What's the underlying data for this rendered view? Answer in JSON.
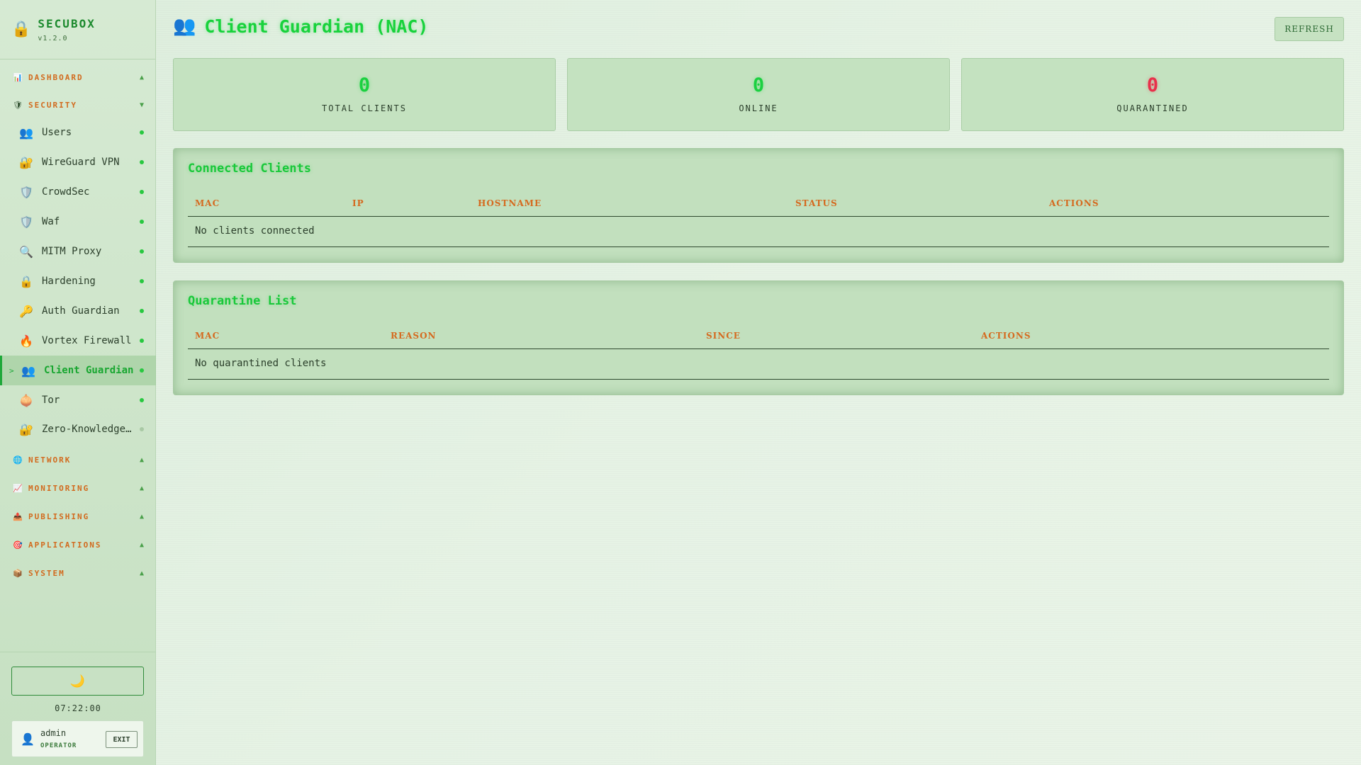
{
  "brand": {
    "title": "SECUBOX",
    "version": "v1.2.0",
    "icon": "lock-icon"
  },
  "nav": {
    "groups": [
      {
        "key": "dashboard",
        "label": "DASHBOARD",
        "icon": "📊",
        "chevron": "▲"
      },
      {
        "key": "security",
        "label": "SECURITY",
        "icon": "🛡",
        "chevron": "▼"
      },
      {
        "key": "network",
        "label": "NETWORK",
        "icon": "🌐",
        "chevron": "▲"
      },
      {
        "key": "monitoring",
        "label": "MONITORING",
        "icon": "📈",
        "chevron": "▲"
      },
      {
        "key": "publishing",
        "label": "PUBLISHING",
        "icon": "📤",
        "chevron": "▲"
      },
      {
        "key": "applications",
        "label": "APPLICATIONS",
        "icon": "🎯",
        "chevron": "▲"
      },
      {
        "key": "system",
        "label": "SYSTEM",
        "icon": "📦",
        "chevron": "▲"
      }
    ],
    "security_items": [
      {
        "label": "Users",
        "icon": "👥",
        "status": "online"
      },
      {
        "label": "WireGuard VPN",
        "icon": "🔐",
        "status": "online"
      },
      {
        "label": "CrowdSec",
        "icon": "🛡️",
        "status": "online"
      },
      {
        "label": "Waf",
        "icon": "🛡️",
        "status": "online"
      },
      {
        "label": "MITM Proxy",
        "icon": "🔍",
        "status": "online"
      },
      {
        "label": "Hardening",
        "icon": "🔒",
        "status": "online"
      },
      {
        "label": "Auth Guardian",
        "icon": "🔑",
        "status": "online"
      },
      {
        "label": "Vortex Firewall",
        "icon": "🔥",
        "status": "online"
      },
      {
        "label": "Client Guardian",
        "icon": "👥",
        "status": "online",
        "active": true
      },
      {
        "label": "Tor",
        "icon": "🧅",
        "status": "online"
      },
      {
        "label": "Zero-Knowledge…",
        "icon": "🔐",
        "status": "offline"
      }
    ],
    "active_marker": ">"
  },
  "footer": {
    "theme_icon": "🌙",
    "clock": "07:22:00",
    "user": {
      "name": "admin",
      "role": "OPERATOR",
      "icon": "👤",
      "exit_label": "EXIT"
    }
  },
  "header": {
    "title": "Client Guardian (NAC)",
    "icon": "👥",
    "refresh_label": "REFRESH"
  },
  "stats": [
    {
      "value": "0",
      "label": "TOTAL CLIENTS",
      "color": "#1bd040"
    },
    {
      "value": "0",
      "label": "ONLINE",
      "color": "#1bd040"
    },
    {
      "value": "0",
      "label": "QUARANTINED",
      "color": "#e8304a"
    }
  ],
  "connected": {
    "title": "Connected Clients",
    "columns": [
      "MAC",
      "IP",
      "HOSTNAME",
      "STATUS",
      "ACTIONS"
    ],
    "empty_text": "No clients connected"
  },
  "quarantine": {
    "title": "Quarantine List",
    "columns": [
      "MAC",
      "REASON",
      "SINCE",
      "ACTIONS"
    ],
    "empty_text": "No quarantined clients"
  }
}
